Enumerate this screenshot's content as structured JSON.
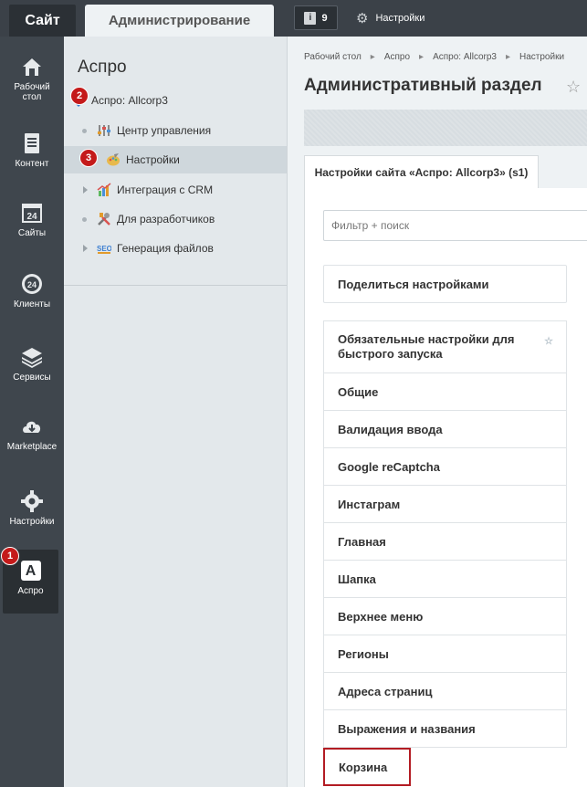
{
  "topbar": {
    "site_tab": "Сайт",
    "admin_tab": "Администрирование",
    "notifications_count": "9",
    "settings_label": "Настройки"
  },
  "rail": {
    "items": [
      {
        "label": "Рабочий стол",
        "icon": "home-icon"
      },
      {
        "label": "Контент",
        "icon": "document-icon"
      },
      {
        "label": "Сайты",
        "icon": "calendar-icon"
      },
      {
        "label": "Клиенты",
        "icon": "clients-icon"
      },
      {
        "label": "Сервисы",
        "icon": "layers-icon"
      },
      {
        "label": "Marketplace",
        "icon": "cloud-download-icon"
      },
      {
        "label": "Настройки",
        "icon": "gear-icon"
      },
      {
        "label": "Аспро",
        "icon": "aspro-icon"
      }
    ]
  },
  "tree": {
    "title": "Аспро",
    "root": "Аспро: Allcorp3",
    "items": [
      {
        "label": "Центр управления",
        "icon": "control-center-icon"
      },
      {
        "label": "Настройки",
        "icon": "settings-palette-icon"
      },
      {
        "label": "Интеграция с CRM",
        "icon": "crm-chart-icon"
      },
      {
        "label": "Для разработчиков",
        "icon": "tools-icon"
      },
      {
        "label": "Генерация файлов",
        "icon": "seo-icon"
      }
    ]
  },
  "badges": {
    "one": "1",
    "two": "2",
    "three": "3"
  },
  "main": {
    "breadcrumbs": [
      "Рабочий стол",
      "Аспро",
      "Аспро: Allcorp3",
      "Настройки"
    ],
    "title": "Административный раздел",
    "tab": "Настройки сайта «Аспро: Allcorp3» (s1)",
    "filter_placeholder": "Фильтр + поиск",
    "share_label": "Поделиться настройками",
    "menu": [
      "Обязательные настройки для быстрого запуска",
      "Общие",
      "Валидация ввода",
      "Google reCaptcha",
      "Инстаграм",
      "Главная",
      "Шапка",
      "Верхнее меню",
      "Регионы",
      "Адреса страниц",
      "Выражения и названия",
      "Корзина"
    ]
  },
  "colors": {
    "accent_red": "#b31c23",
    "rail_bg": "#3f464d",
    "topbar_bg": "#3b4148"
  }
}
